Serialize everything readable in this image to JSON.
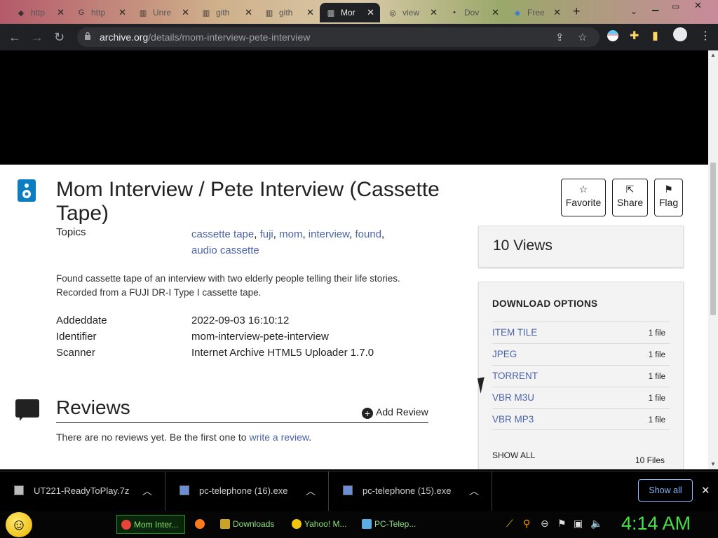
{
  "browser": {
    "tabs": [
      {
        "label": "http",
        "icon": "chrome-tab-icon"
      },
      {
        "label": "http",
        "icon": "google-icon"
      },
      {
        "label": "Unre",
        "icon": "archive-icon"
      },
      {
        "label": "gith",
        "icon": "archive-icon"
      },
      {
        "label": "gith",
        "icon": "archive-icon"
      },
      {
        "label": "Mor",
        "icon": "archive-icon",
        "active": true
      },
      {
        "label": "view",
        "icon": "gear-icon"
      },
      {
        "label": "Dov",
        "icon": "dot-icon"
      },
      {
        "label": "Free",
        "icon": "cloud-icon"
      }
    ],
    "url_host": "archive.org",
    "url_path": "/details/mom-interview-pete-interview"
  },
  "item": {
    "title": "Mom Interview / Pete Interview (Cassette Tape)",
    "topics_label": "Topics",
    "topics": [
      "cassette tape",
      "fuji",
      "mom",
      "interview",
      "found",
      "audio cassette"
    ],
    "description_line1": "Found cassette tape of an interview with two elderly people telling their life stories.",
    "description_line2": "Recorded from a FUJI DR-I Type I cassette tape.",
    "metadata": [
      {
        "key": "Addeddate",
        "value": "2022-09-03 16:10:12"
      },
      {
        "key": "Identifier",
        "value": "mom-interview-pete-interview"
      },
      {
        "key": "Scanner",
        "value": "Internet Archive HTML5 Uploader 1.7.0"
      }
    ]
  },
  "actions": {
    "favorite": "Favorite",
    "share": "Share",
    "flag": "Flag"
  },
  "views": "10 Views",
  "downloads": {
    "heading": "DOWNLOAD OPTIONS",
    "rows": [
      {
        "format": "ITEM TILE",
        "count": "1 file"
      },
      {
        "format": "JPEG",
        "count": "1 file"
      },
      {
        "format": "TORRENT",
        "count": "1 file"
      },
      {
        "format": "VBR M3U",
        "count": "1 file"
      },
      {
        "format": "VBR MP3",
        "count": "1 file"
      }
    ],
    "show_all": "SHOW ALL",
    "total": "10 Files"
  },
  "reviews": {
    "heading": "Reviews",
    "add_label": "Add Review",
    "none_text": "There are no reviews yet. Be the first one to ",
    "write_link": "write a review",
    "period": "."
  },
  "downloads_shelf": {
    "items": [
      {
        "name": "UT221-ReadyToPlay.7z"
      },
      {
        "name": "pc-telephone (16).exe"
      },
      {
        "name": "pc-telephone (15).exe"
      }
    ],
    "show_all": "Show all"
  },
  "taskbar": {
    "items": [
      {
        "label": "Mom Inter...",
        "color": "#e8443a"
      },
      {
        "label": "",
        "color": "#ff7a1a"
      },
      {
        "label": "Downloads",
        "color": "#c9a227"
      },
      {
        "label": "Yahoo! M...",
        "color": "#f1c40f"
      },
      {
        "label": "PC-Telep...",
        "color": "#5dade2"
      }
    ],
    "clock": "4:14 AM"
  }
}
